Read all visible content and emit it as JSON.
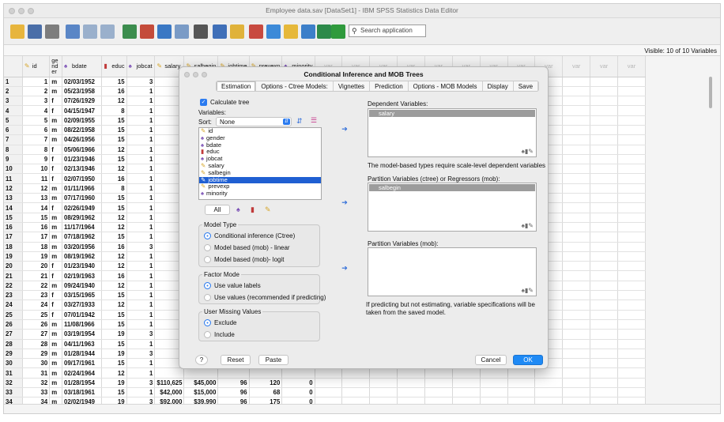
{
  "window": {
    "title": "Employee data.sav [DataSet1] - IBM SPSS Statistics Data Editor"
  },
  "toolbar": {
    "search_placeholder": "Search application"
  },
  "visible_label": "Visible: 10 of 10 Variables",
  "columns": [
    {
      "label": "id",
      "icon": "ruler-icon",
      "width": 38
    },
    {
      "label": "ge nd er",
      "icon": "",
      "width": 16
    },
    {
      "label": "bdate",
      "icon": "nominal-icon",
      "width": 52
    },
    {
      "label": "educ",
      "icon": "bar-icon",
      "width": 30
    },
    {
      "label": "jobcat",
      "icon": "nominal-icon",
      "width": 36
    },
    {
      "label": "salary",
      "icon": "ruler-icon",
      "width": 34
    },
    {
      "label": "salbegin",
      "icon": "ruler-icon",
      "width": 40
    },
    {
      "label": "jobtime",
      "icon": "ruler-icon",
      "width": 38
    },
    {
      "label": "prevexp",
      "icon": "ruler-icon",
      "width": 38
    },
    {
      "label": "minority",
      "icon": "nominal-icon",
      "width": 38
    }
  ],
  "var_placeholder": "var",
  "var_count": 12,
  "rows": [
    [
      "1",
      "1",
      "m",
      "02/03/1952",
      "15",
      "3",
      "",
      "",
      "",
      "",
      ""
    ],
    [
      "2",
      "2",
      "m",
      "05/23/1958",
      "16",
      "1",
      "",
      "",
      "",
      "",
      ""
    ],
    [
      "3",
      "3",
      "f",
      "07/26/1929",
      "12",
      "1",
      "",
      "",
      "",
      "",
      ""
    ],
    [
      "4",
      "4",
      "f",
      "04/15/1947",
      "8",
      "1",
      "",
      "",
      "",
      "",
      ""
    ],
    [
      "5",
      "5",
      "m",
      "02/09/1955",
      "15",
      "1",
      "",
      "",
      "",
      "",
      ""
    ],
    [
      "6",
      "6",
      "m",
      "08/22/1958",
      "15",
      "1",
      "",
      "",
      "",
      "",
      ""
    ],
    [
      "7",
      "7",
      "m",
      "04/26/1956",
      "15",
      "1",
      "",
      "",
      "",
      "",
      ""
    ],
    [
      "8",
      "8",
      "f",
      "05/06/1966",
      "12",
      "1",
      "",
      "",
      "",
      "",
      ""
    ],
    [
      "9",
      "9",
      "f",
      "01/23/1946",
      "15",
      "1",
      "",
      "",
      "",
      "",
      ""
    ],
    [
      "10",
      "10",
      "f",
      "02/13/1946",
      "12",
      "1",
      "",
      "",
      "",
      "",
      ""
    ],
    [
      "11",
      "11",
      "f",
      "02/07/1950",
      "16",
      "1",
      "",
      "",
      "",
      "",
      ""
    ],
    [
      "12",
      "12",
      "m",
      "01/11/1966",
      "8",
      "1",
      "",
      "",
      "",
      "",
      ""
    ],
    [
      "13",
      "13",
      "m",
      "07/17/1960",
      "15",
      "1",
      "",
      "",
      "",
      "",
      ""
    ],
    [
      "14",
      "14",
      "f",
      "02/26/1949",
      "15",
      "1",
      "",
      "",
      "",
      "",
      ""
    ],
    [
      "15",
      "15",
      "m",
      "08/29/1962",
      "12",
      "1",
      "",
      "",
      "",
      "",
      ""
    ],
    [
      "16",
      "16",
      "m",
      "11/17/1964",
      "12",
      "1",
      "",
      "",
      "",
      "",
      ""
    ],
    [
      "17",
      "17",
      "m",
      "07/18/1962",
      "15",
      "1",
      "",
      "",
      "",
      "",
      ""
    ],
    [
      "18",
      "18",
      "m",
      "03/20/1956",
      "16",
      "3",
      "",
      "",
      "",
      "",
      ""
    ],
    [
      "19",
      "19",
      "m",
      "08/19/1962",
      "12",
      "1",
      "",
      "",
      "",
      "",
      ""
    ],
    [
      "20",
      "20",
      "f",
      "01/23/1940",
      "12",
      "1",
      "",
      "",
      "",
      "",
      ""
    ],
    [
      "21",
      "21",
      "f",
      "02/19/1963",
      "16",
      "1",
      "",
      "",
      "",
      "",
      ""
    ],
    [
      "22",
      "22",
      "m",
      "09/24/1940",
      "12",
      "1",
      "",
      "",
      "",
      "",
      ""
    ],
    [
      "23",
      "23",
      "f",
      "03/15/1965",
      "15",
      "1",
      "",
      "",
      "",
      "",
      ""
    ],
    [
      "24",
      "24",
      "f",
      "03/27/1933",
      "12",
      "1",
      "",
      "",
      "",
      "",
      ""
    ],
    [
      "25",
      "25",
      "f",
      "07/01/1942",
      "15",
      "1",
      "",
      "",
      "",
      "",
      ""
    ],
    [
      "26",
      "26",
      "m",
      "11/08/1966",
      "15",
      "1",
      "",
      "",
      "",
      "",
      ""
    ],
    [
      "27",
      "27",
      "m",
      "03/19/1954",
      "19",
      "3",
      "",
      "",
      "",
      "",
      ""
    ],
    [
      "28",
      "28",
      "m",
      "04/11/1963",
      "15",
      "1",
      "",
      "",
      "",
      "",
      ""
    ],
    [
      "29",
      "29",
      "m",
      "01/28/1944",
      "19",
      "3",
      "",
      "",
      "",
      "",
      ""
    ],
    [
      "30",
      "30",
      "m",
      "09/17/1961",
      "15",
      "1",
      "",
      "",
      "",
      "",
      ""
    ],
    [
      "31",
      "31",
      "m",
      "02/24/1964",
      "12",
      "1",
      "",
      "",
      "",
      "",
      ""
    ],
    [
      "32",
      "32",
      "m",
      "01/28/1954",
      "19",
      "3",
      "$110,625",
      "$45,000",
      "96",
      "120",
      "0"
    ],
    [
      "33",
      "33",
      "m",
      "03/18/1961",
      "15",
      "1",
      "$42,000",
      "$15,000",
      "96",
      "68",
      "0"
    ],
    [
      "34",
      "34",
      "m",
      "02/02/1949",
      "19",
      "3",
      "$92,000",
      "$39,990",
      "96",
      "175",
      "0"
    ]
  ],
  "dialog": {
    "title": "Conditional Inference and MOB Trees",
    "tabs": [
      "Estimation",
      "Options - Ctree Models:",
      "Vignettes",
      "Prediction",
      "Options - MOB Models",
      "Display",
      "Save"
    ],
    "calc_tree": "Calculate tree",
    "variables_label": "Variables:",
    "sort_label": "Sort:",
    "sort_value": "None",
    "variables": [
      {
        "name": "id",
        "icon": "ruler-icon"
      },
      {
        "name": "gender",
        "icon": "nominal-icon"
      },
      {
        "name": "bdate",
        "icon": "nominal-icon"
      },
      {
        "name": "educ",
        "icon": "bar-icon"
      },
      {
        "name": "jobcat",
        "icon": "nominal-icon"
      },
      {
        "name": "salary",
        "icon": "ruler-icon"
      },
      {
        "name": "salbegin",
        "icon": "ruler-icon"
      },
      {
        "name": "jobtime",
        "icon": "ruler-icon",
        "selected": true
      },
      {
        "name": "prevexp",
        "icon": "ruler-icon"
      },
      {
        "name": "minority",
        "icon": "nominal-icon"
      }
    ],
    "all_label": "All",
    "model_type": {
      "title": "Model Type",
      "options": [
        "Conditional inference (Ctree)",
        "Model based (mob) - linear",
        "Model based (mob)- logit"
      ]
    },
    "factor_mode": {
      "title": "Factor Mode",
      "options": [
        "Use value labels",
        "Use values (recommended if predicting)"
      ]
    },
    "missing": {
      "title": "User Missing Values",
      "options": [
        "Exclude",
        "Include"
      ]
    },
    "dependent_label": "Dependent Variables:",
    "dependent_value": "salary",
    "dependent_note": "The model-based types require scale-level dependent variables",
    "partition_label": "Partition Variables (ctree) or Regressors (mob):",
    "partition_value": "salbegin",
    "partition_mob_label": "Partition Variables (mob):",
    "predict_note": "If predicting but not estimating, variable specifications will be taken  from the saved model.",
    "help_label": "?",
    "reset_label": "Reset",
    "paste_label": "Paste",
    "cancel_label": "Cancel",
    "ok_label": "OK"
  },
  "colors": {
    "accent": "#1f8af5",
    "selection": "#1f5fd2"
  }
}
